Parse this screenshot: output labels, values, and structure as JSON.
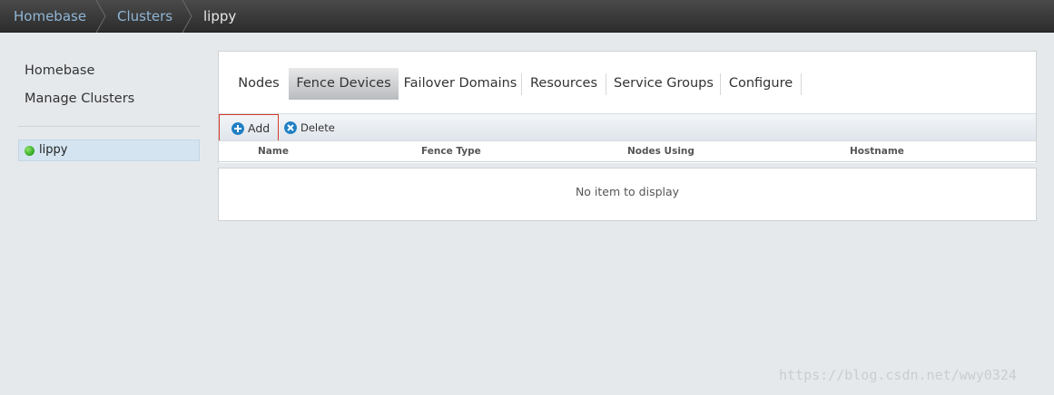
{
  "breadcrumb": {
    "items": [
      {
        "label": "Homebase"
      },
      {
        "label": "Clusters"
      },
      {
        "label": "lippy"
      }
    ]
  },
  "leftnav": {
    "links": [
      {
        "label": "Homebase"
      },
      {
        "label": "Manage Clusters"
      }
    ],
    "clusters": [
      {
        "label": "lippy",
        "status": "online",
        "status_color": "#2ea51f"
      }
    ]
  },
  "tabs": [
    {
      "label": "Nodes",
      "active": false
    },
    {
      "label": "Fence Devices",
      "active": true
    },
    {
      "label": "Failover Domains",
      "active": false
    },
    {
      "label": "Resources",
      "active": false
    },
    {
      "label": "Service Groups",
      "active": false
    },
    {
      "label": "Configure",
      "active": false
    }
  ],
  "toolbar": {
    "add_label": "Add",
    "add_icon": "plus-circle-icon",
    "delete_label": "Delete",
    "delete_icon": "x-circle-icon"
  },
  "table": {
    "columns": [
      "Name",
      "Fence Type",
      "Nodes Using",
      "Hostname"
    ],
    "rows": [],
    "empty_text": "No item to display"
  },
  "watermark": "https://blog.csdn.net/wwy0324",
  "colors": {
    "link": "#8fb6d6",
    "selected_bg": "#d4e5f1",
    "highlight_border": "#d43a2c",
    "icon_blue": "#1f7fc4"
  }
}
